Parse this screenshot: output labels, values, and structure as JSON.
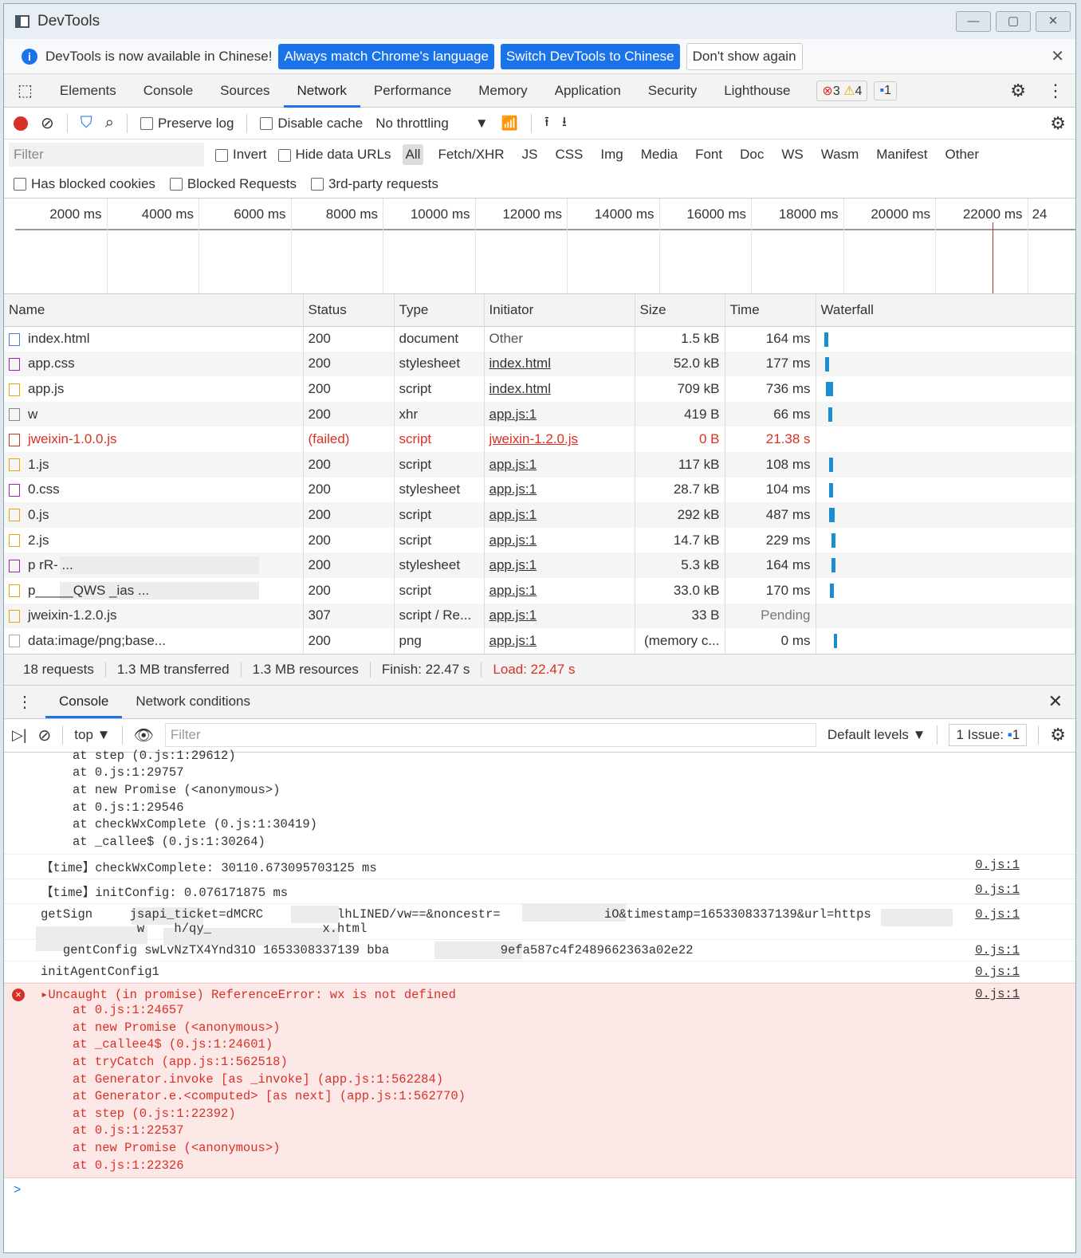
{
  "window": {
    "title": "DevTools"
  },
  "infobar": {
    "message": "DevTools is now available in Chinese!",
    "btn_match": "Always match Chrome's language",
    "btn_switch": "Switch DevTools to Chinese",
    "btn_dont": "Don't show again"
  },
  "tabs": [
    "Elements",
    "Console",
    "Sources",
    "Network",
    "Performance",
    "Memory",
    "Application",
    "Security",
    "Lighthouse"
  ],
  "active_tab": "Network",
  "badges": {
    "errors": "3",
    "warnings": "4",
    "issues": "1"
  },
  "toolbar": {
    "preserve_log": "Preserve log",
    "disable_cache": "Disable cache",
    "throttling": "No throttling"
  },
  "filter": {
    "placeholder": "Filter",
    "invert": "Invert",
    "hide_data_urls": "Hide data URLs",
    "types": [
      "All",
      "Fetch/XHR",
      "JS",
      "CSS",
      "Img",
      "Media",
      "Font",
      "Doc",
      "WS",
      "Wasm",
      "Manifest",
      "Other"
    ]
  },
  "checks": [
    "Has blocked cookies",
    "Blocked Requests",
    "3rd-party requests"
  ],
  "timeline": [
    "2000 ms",
    "4000 ms",
    "6000 ms",
    "8000 ms",
    "10000 ms",
    "12000 ms",
    "14000 ms",
    "16000 ms",
    "18000 ms",
    "20000 ms",
    "22000 ms",
    "24"
  ],
  "columns": [
    "Name",
    "Status",
    "Type",
    "Initiator",
    "Size",
    "Time",
    "Waterfall"
  ],
  "rows": [
    {
      "name": "index.html",
      "status": "200",
      "type": "document",
      "initiator": "Other",
      "size": "1.5 kB",
      "time": "164 ms",
      "icon": "doc"
    },
    {
      "name": "app.css",
      "status": "200",
      "type": "stylesheet",
      "initiator": "index.html",
      "size": "52.0 kB",
      "time": "177 ms",
      "icon": "css"
    },
    {
      "name": "app.js",
      "status": "200",
      "type": "script",
      "initiator": "index.html",
      "size": "709 kB",
      "time": "736 ms",
      "icon": "js"
    },
    {
      "name": "w",
      "status": "200",
      "type": "xhr",
      "initiator": "app.js:1",
      "size": "419 B",
      "time": "66 ms",
      "icon": "xhr"
    },
    {
      "name": "jweixin-1.0.0.js",
      "status": "(failed)",
      "type": "script",
      "initiator": "jweixin-1.2.0.js",
      "size": "0 B",
      "time": "21.38 s",
      "icon": "js",
      "failed": true
    },
    {
      "name": "1.js",
      "status": "200",
      "type": "script",
      "initiator": "app.js:1",
      "size": "117 kB",
      "time": "108 ms",
      "icon": "js"
    },
    {
      "name": "0.css",
      "status": "200",
      "type": "stylesheet",
      "initiator": "app.js:1",
      "size": "28.7 kB",
      "time": "104 ms",
      "icon": "css"
    },
    {
      "name": "0.js",
      "status": "200",
      "type": "script",
      "initiator": "app.js:1",
      "size": "292 kB",
      "time": "487 ms",
      "icon": "js"
    },
    {
      "name": "2.js",
      "status": "200",
      "type": "script",
      "initiator": "app.js:1",
      "size": "14.7 kB",
      "time": "229 ms",
      "icon": "js"
    },
    {
      "name": "p        rR-       ...",
      "status": "200",
      "type": "stylesheet",
      "initiator": "app.js:1",
      "size": "5.3 kB",
      "time": "164 ms",
      "icon": "css",
      "blurred": true
    },
    {
      "name": "p_____QWS      _ias     ...",
      "status": "200",
      "type": "script",
      "initiator": "app.js:1",
      "size": "33.0 kB",
      "time": "170 ms",
      "icon": "js",
      "blurred": true
    },
    {
      "name": "jweixin-1.2.0.js",
      "status": "307",
      "type": "script / Re...",
      "initiator": "app.js:1",
      "size": "33 B",
      "time": "Pending",
      "icon": "js"
    },
    {
      "name": "data:image/png;base...",
      "status": "200",
      "type": "png",
      "initiator": "app.js:1",
      "size": "(memory c...",
      "time": "0 ms",
      "icon": "img"
    }
  ],
  "summary": {
    "requests": "18 requests",
    "transferred": "1.3 MB transferred",
    "resources": "1.3 MB resources",
    "finish": "Finish: 22.47 s",
    "load": "Load: 22.47 s"
  },
  "drawer": {
    "tabs": [
      "Console",
      "Network conditions"
    ],
    "context": "top",
    "filter_placeholder": "Filter",
    "levels": "Default levels",
    "issues_label": "1 Issue:",
    "issues_count": "1"
  },
  "console": {
    "stack_top": [
      "at step (0.js:1:29612)",
      "at 0.js:1:29757",
      "at new Promise (<anonymous>)",
      "at 0.js:1:29546",
      "at checkWxComplete (0.js:1:30419)",
      "at _callee$ (0.js:1:30264)"
    ],
    "lines": [
      {
        "text": "【time】checkWxComplete: 30110.673095703125 ms",
        "src": "0.js:1"
      },
      {
        "text": "【time】initConfig: 0.076171875 ms",
        "src": "0.js:1"
      },
      {
        "text": "getSign     jsapi_ticket=dMCRC          lhLINED/vw==&noncestr=              iO&timestamp=1653308337139&url=https\n             w    h/qy_               x.html",
        "src": "0.js:1"
      },
      {
        "text": "   gentConfig swLvNzTX4Ynd31O 1653308337139 bba               9efa587c4f2489662363a02e22",
        "src": "0.js:1"
      },
      {
        "text": "initAgentConfig1",
        "src": "0.js:1"
      }
    ],
    "error": {
      "message": "Uncaught (in promise) ReferenceError: wx is not defined",
      "src": "0.js:1",
      "stack": [
        "at 0.js:1:24657",
        "at new Promise (<anonymous>)",
        "at _callee4$ (0.js:1:24601)",
        "at tryCatch (app.js:1:562518)",
        "at Generator.invoke [as _invoke] (app.js:1:562284)",
        "at Generator.e.<computed> [as next] (app.js:1:562770)",
        "at step (0.js:1:22392)",
        "at 0.js:1:22537",
        "at new Promise (<anonymous>)",
        "at 0.js:1:22326"
      ]
    },
    "prompt": ">"
  },
  "colors": {
    "accent": "#1a73e8",
    "error": "#d93025",
    "error_bg": "#fde8e8"
  }
}
